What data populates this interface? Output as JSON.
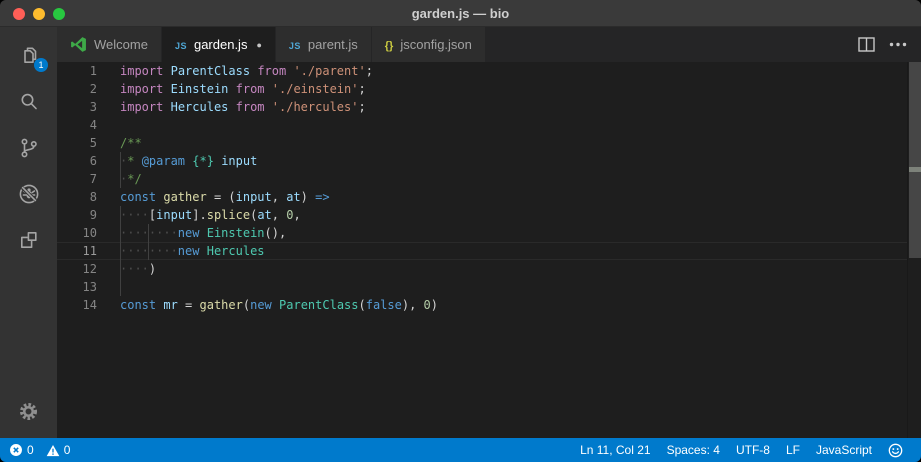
{
  "window": {
    "title": "garden.js — bio",
    "traffic_lights": [
      {
        "name": "close",
        "color": "#FF5F57"
      },
      {
        "name": "minimize",
        "color": "#FEBC2E"
      },
      {
        "name": "zoom",
        "color": "#28C840"
      }
    ]
  },
  "activity_bar": {
    "items": [
      {
        "name": "explorer",
        "icon": "files",
        "badge": "1"
      },
      {
        "name": "search",
        "icon": "search"
      },
      {
        "name": "source-control",
        "icon": "scm"
      },
      {
        "name": "debug",
        "icon": "debug"
      },
      {
        "name": "extensions",
        "icon": "extensions"
      }
    ],
    "bottom": [
      {
        "name": "settings",
        "icon": "gear"
      }
    ]
  },
  "tab_bar": {
    "tabs": [
      {
        "label": "Welcome",
        "icon": "vscode-logo",
        "active": false,
        "modified": false
      },
      {
        "label": "garden.js",
        "icon": "js",
        "active": true,
        "modified": true
      },
      {
        "label": "parent.js",
        "icon": "js",
        "active": false,
        "modified": false
      },
      {
        "label": "jsconfig.json",
        "icon": "braces",
        "active": false,
        "modified": false
      }
    ],
    "actions": [
      {
        "name": "split-editor",
        "icon": "split"
      },
      {
        "name": "more-actions",
        "icon": "ellipsis"
      }
    ]
  },
  "editor": {
    "language": "javascript",
    "current_line": 11,
    "token_colors": {
      "kw": "#C586C0",
      "kb": "#569CD6",
      "var": "#9CDCFE",
      "cls": "#4EC9B0",
      "fn": "#DCDCAA",
      "str": "#CE9178",
      "num": "#B5CEA8",
      "cmt": "#6A9955",
      "pun": "#D4D4D4",
      "ws": "#4D4D4D"
    },
    "guides": {
      "6": [
        0
      ],
      "7": [
        0
      ],
      "9": [
        0
      ],
      "10": [
        0,
        4
      ],
      "11": [
        0,
        4
      ],
      "12": [
        0
      ],
      "13": [
        0
      ]
    },
    "lines": [
      {
        "n": 1,
        "t": [
          [
            "kw",
            "import"
          ],
          [
            "pun",
            " "
          ],
          [
            "var",
            "ParentClass"
          ],
          [
            "pun",
            " "
          ],
          [
            "kw",
            "from"
          ],
          [
            "pun",
            " "
          ],
          [
            "str",
            "'./parent'"
          ],
          [
            "pun",
            ";"
          ]
        ]
      },
      {
        "n": 2,
        "t": [
          [
            "kw",
            "import"
          ],
          [
            "pun",
            " "
          ],
          [
            "var",
            "Einstein"
          ],
          [
            "pun",
            " "
          ],
          [
            "kw",
            "from"
          ],
          [
            "pun",
            " "
          ],
          [
            "str",
            "'./einstein'"
          ],
          [
            "pun",
            ";"
          ]
        ]
      },
      {
        "n": 3,
        "t": [
          [
            "kw",
            "import"
          ],
          [
            "pun",
            " "
          ],
          [
            "var",
            "Hercules"
          ],
          [
            "pun",
            " "
          ],
          [
            "kw",
            "from"
          ],
          [
            "pun",
            " "
          ],
          [
            "str",
            "'./hercules'"
          ],
          [
            "pun",
            ";"
          ]
        ]
      },
      {
        "n": 4,
        "t": []
      },
      {
        "n": 5,
        "t": [
          [
            "cmt",
            "/**"
          ]
        ]
      },
      {
        "n": 6,
        "t": [
          [
            "ws",
            " "
          ],
          [
            "cmt",
            "* "
          ],
          [
            "kb",
            "@param"
          ],
          [
            "cmt",
            " "
          ],
          [
            "cls",
            "{*}"
          ],
          [
            "cmt",
            " "
          ],
          [
            "var",
            "input"
          ]
        ]
      },
      {
        "n": 7,
        "t": [
          [
            "ws",
            " "
          ],
          [
            "cmt",
            "*/"
          ]
        ]
      },
      {
        "n": 8,
        "t": [
          [
            "kb",
            "const"
          ],
          [
            "pun",
            " "
          ],
          [
            "fn",
            "gather"
          ],
          [
            "pun",
            " = ("
          ],
          [
            "var",
            "input"
          ],
          [
            "pun",
            ", "
          ],
          [
            "var",
            "at"
          ],
          [
            "pun",
            ") "
          ],
          [
            "kb",
            "=>"
          ]
        ]
      },
      {
        "n": 9,
        "t": [
          [
            "ws",
            "    "
          ],
          [
            "pun",
            "["
          ],
          [
            "var",
            "input"
          ],
          [
            "pun",
            "]."
          ],
          [
            "fn",
            "splice"
          ],
          [
            "pun",
            "("
          ],
          [
            "var",
            "at"
          ],
          [
            "pun",
            ", "
          ],
          [
            "num",
            "0"
          ],
          [
            "pun",
            ","
          ]
        ]
      },
      {
        "n": 10,
        "t": [
          [
            "ws",
            "        "
          ],
          [
            "kb",
            "new"
          ],
          [
            "pun",
            " "
          ],
          [
            "cls",
            "Einstein"
          ],
          [
            "pun",
            "(),"
          ]
        ]
      },
      {
        "n": 11,
        "t": [
          [
            "ws",
            "        "
          ],
          [
            "kb",
            "new"
          ],
          [
            "pun",
            " "
          ],
          [
            "cls",
            "Hercules"
          ]
        ]
      },
      {
        "n": 12,
        "t": [
          [
            "ws",
            "    "
          ],
          [
            "pun",
            ")"
          ]
        ]
      },
      {
        "n": 13,
        "t": []
      },
      {
        "n": 14,
        "t": [
          [
            "kb",
            "const"
          ],
          [
            "pun",
            " "
          ],
          [
            "var",
            "mr"
          ],
          [
            "pun",
            " = "
          ],
          [
            "fn",
            "gather"
          ],
          [
            "pun",
            "("
          ],
          [
            "kb",
            "new"
          ],
          [
            "pun",
            " "
          ],
          [
            "cls",
            "ParentClass"
          ],
          [
            "pun",
            "("
          ],
          [
            "kb",
            "false"
          ],
          [
            "pun",
            "), "
          ],
          [
            "num",
            "0"
          ],
          [
            "pun",
            ")"
          ]
        ]
      }
    ]
  },
  "status_bar": {
    "problems": [
      {
        "name": "errors",
        "icon": "error",
        "count": "0"
      },
      {
        "name": "warnings",
        "icon": "warning",
        "count": "0"
      }
    ],
    "right": [
      {
        "name": "cursor-position",
        "label": "Ln 11, Col 21"
      },
      {
        "name": "indentation",
        "label": "Spaces: 4"
      },
      {
        "name": "encoding",
        "label": "UTF-8"
      },
      {
        "name": "eol",
        "label": "LF"
      },
      {
        "name": "language-mode",
        "label": "JavaScript"
      },
      {
        "name": "feedback",
        "icon": "smiley"
      }
    ]
  },
  "colors": {
    "accent": "#007ACC",
    "badge": "#007ACC",
    "title_bar_bg": "#3A3A3A",
    "tab_bar_bg": "#252526",
    "inactive_tab_bg": "#2D2D2D",
    "active_tab_bg": "#1E1E1E",
    "editor_bg": "#1E1E1E",
    "activity_bar_bg": "#333333",
    "js_icon": "#4FA7D5",
    "json_icon": "#CBCB41",
    "welcome_icon": "#3EA948"
  }
}
